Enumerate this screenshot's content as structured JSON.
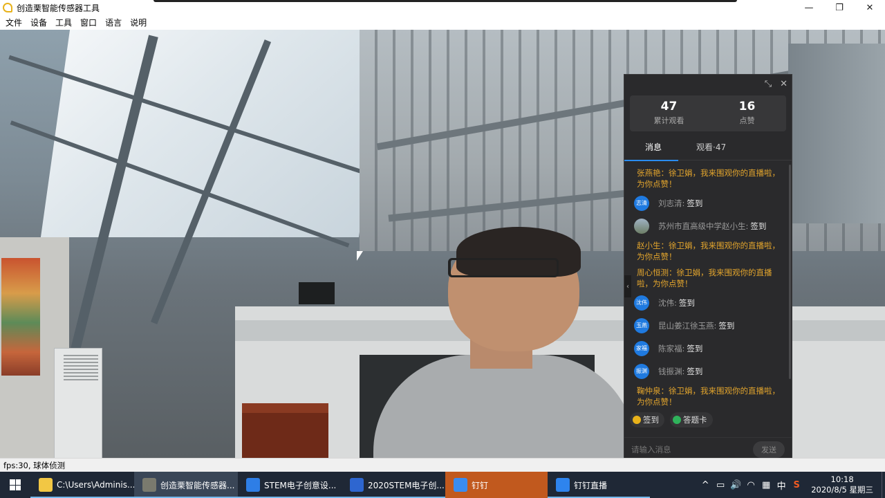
{
  "window": {
    "title": "创造栗智能传感器工具",
    "controls": {
      "minimize": "—",
      "maximize": "❐",
      "close": "✕"
    }
  },
  "menu": [
    "文件",
    "设备",
    "工具",
    "窗口",
    "语言",
    "说明"
  ],
  "live_panel": {
    "stats": [
      {
        "value": "47",
        "label": "累计观看"
      },
      {
        "value": "16",
        "label": "点赞"
      }
    ],
    "tabs": [
      {
        "label": "消息",
        "active": true
      },
      {
        "label": "观看·47",
        "active": false
      }
    ],
    "messages": [
      {
        "type": "gold",
        "text": "张燕艳：徐卫娟，我来围观你的直播啦，为你点赞！"
      },
      {
        "type": "user",
        "avatar": "志清",
        "name": "刘志清:",
        "action": "签到"
      },
      {
        "type": "user",
        "avatar": "",
        "avatar_image": true,
        "name": "苏州市直高级中学赵小生:",
        "action": "签到"
      },
      {
        "type": "gold",
        "text": "赵小生：徐卫娟，我来围观你的直播啦，为你点赞！"
      },
      {
        "type": "gold",
        "text": "周心恒测：徐卫娟，我来围观你的直播啦，为你点赞！"
      },
      {
        "type": "user",
        "avatar": "沈伟",
        "name": "沈伟:",
        "action": "签到"
      },
      {
        "type": "user",
        "avatar": "玉燕",
        "name": "昆山姜江徐玉燕:",
        "action": "签到"
      },
      {
        "type": "user",
        "avatar": "家福",
        "name": "陈家福:",
        "action": "签到"
      },
      {
        "type": "user",
        "avatar": "振渊",
        "name": "钱振渊:",
        "action": "签到"
      },
      {
        "type": "gold",
        "text": "鞠仲泉：徐卫娟，我来围观你的直播啦，为你点赞！"
      }
    ],
    "chips": [
      {
        "label": "签到",
        "color": "#e8b21a"
      },
      {
        "label": "答题卡",
        "color": "#2fb35b"
      }
    ],
    "input_placeholder": "请输入消息",
    "send_label": "发送"
  },
  "status": "fps:30,  球体侦测",
  "taskbar": {
    "items": [
      {
        "label": "C:\\Users\\Adminis...",
        "icon_color": "#f2c744"
      },
      {
        "label": "创造栗智能传感器...",
        "icon_color": "#7a7a6e"
      },
      {
        "label": "STEM电子创意设...",
        "icon_color": "#2e7ee6"
      },
      {
        "label": "2020STEM电子创...",
        "icon_color": "#2e66d0"
      },
      {
        "label": "钉钉",
        "icon_color": "#3a8cf0"
      },
      {
        "label": "钉钉直播",
        "icon_color": "#2e84ee"
      }
    ],
    "tray": {
      "icons": [
        "^",
        "▭",
        "🔊",
        "◠",
        "▦",
        "中",
        "S"
      ],
      "time": "10:18",
      "date": "2020/8/5 星期三"
    }
  }
}
